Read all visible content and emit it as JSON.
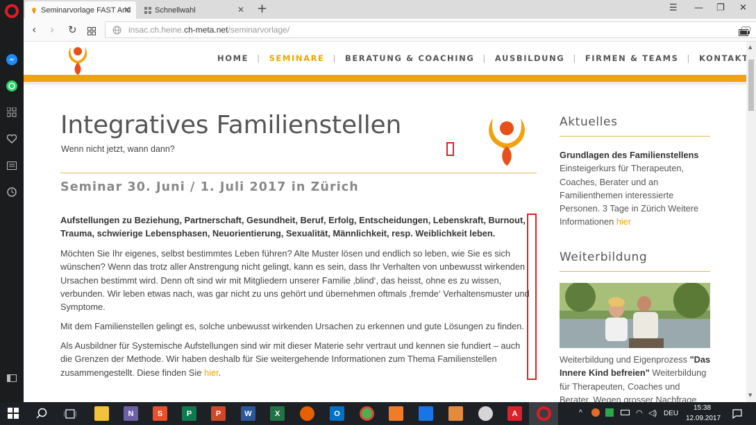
{
  "browser": {
    "tabs": [
      {
        "title": "Seminarvorlage FAST And",
        "active": true
      },
      {
        "title": "Schnellwahl",
        "active": false
      }
    ],
    "url_prefix": "insac.ch.heine.",
    "url_domain": "ch-meta.net",
    "url_path": "/seminarvorlage/"
  },
  "site": {
    "menu": [
      "HOME",
      "SEMINARE",
      "BERATUNG & COACHING",
      "AUSBILDUNG",
      "FIRMEN & TEAMS",
      "KONTAKT"
    ],
    "menu_active_index": 1,
    "menu_separator": "|",
    "accent_color": "#f2a20c"
  },
  "main": {
    "title": "Integratives Familienstellen",
    "subtitle": "Wenn nicht jetzt, wann dann?",
    "seminar_heading": "Seminar 30. Juni / 1. Juli 2017 in Zürich",
    "intro_bold": "Aufstellungen zu Beziehung, Partnerschaft, Gesundheit, Beruf, Erfolg, Entscheidungen, Lebenskraft, Burnout, Trauma, schwierige Lebensphasen, Neuorientierung, Sexualität, Männlichkeit, resp. Weiblichkeit leben.",
    "para1": "Möchten Sie Ihr eigenes, selbst bestimmtes Leben führen? Alte Muster lösen und endlich so leben, wie Sie es sich wünschen? Wenn das trotz aller Anstrengung nicht gelingt, kann es sein, dass Ihr Verhalten von unbewusst wirkenden Ursachen bestimmt wird. Denn oft sind wir mit Mitgliedern unserer Familie ‚blind‘, das heisst, ohne es zu wissen, verbunden. Wir leben etwas nach, was gar nicht zu uns gehört und übernehmen oftmals ‚fremde‘ Verhaltensmuster und Symptome.",
    "para2": "Mit dem Familienstellen gelingt es, solche unbewusst wirkenden Ursachen zu erkennen und gute Lösungen zu finden.",
    "para3_text": "Als Ausbildner für Systemische Aufstellungen sind wir mit dieser Materie sehr vertraut und kennen sie fundiert – auch die Grenzen der Methode. Wir haben deshalb für Sie weitergehende Informationen zum Thema Familienstellen zusammengestellt. Diese finden Sie ",
    "para3_link": "hier",
    "para3_end": "."
  },
  "aside": {
    "news_heading": "Aktuelles",
    "news_title": "Grundlagen des Familienstellens",
    "news_text": " Einsteigerkurs für Therapeuten, Coaches, Berater und an Familienthemen interessierte Personen. 3 Tage in Zürich Weitere Informationen ",
    "news_link": "hier",
    "training_heading": "Weiterbildung",
    "training_text_pre": "Weiterbildung und Eigenprozess ",
    "training_title": "\"Das Innere Kind befreien\"",
    "training_text": " Weiterbildung für Therapeuten, Coaches und Berater. Wegen grosser Nachfrage zusätzlicher"
  },
  "taskbar": {
    "language": "DEU",
    "time": "15:38",
    "date": "12.09.2017"
  }
}
